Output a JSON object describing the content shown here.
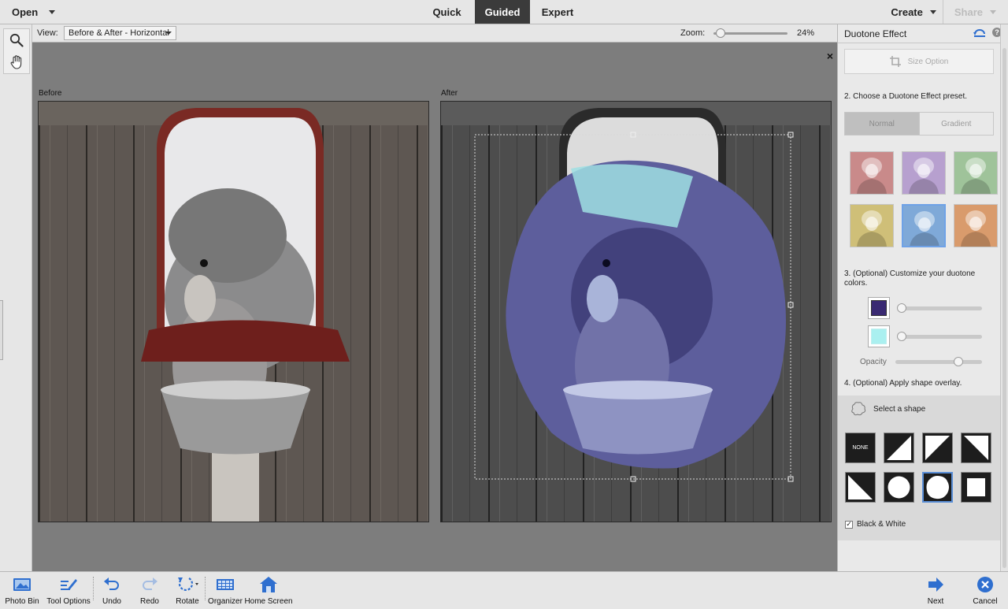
{
  "topbar": {
    "open_label": "Open",
    "modes": [
      {
        "label": "Quick",
        "active": false
      },
      {
        "label": "Guided",
        "active": true
      },
      {
        "label": "Expert",
        "active": false
      }
    ],
    "create_label": "Create",
    "share_label": "Share"
  },
  "viewbar": {
    "view_label": "View:",
    "view_value": "Before & After - Horizontal",
    "zoom_label": "Zoom:",
    "zoom_value": "24%",
    "zoom_level_fraction": 0.04
  },
  "canvas": {
    "before_label": "Before",
    "after_label": "After",
    "close_glyph": "×"
  },
  "panel": {
    "title": "Duotone Effect",
    "size_option": "Size Option",
    "step2": "2. Choose a Duotone Effect preset.",
    "segments": [
      {
        "label": "Normal",
        "active": true
      },
      {
        "label": "Gradient",
        "active": false
      }
    ],
    "presets": [
      {
        "name": "rose",
        "color": "#c98a8a",
        "selected": false
      },
      {
        "name": "lilac",
        "color": "#b7a0cf",
        "selected": false
      },
      {
        "name": "green",
        "color": "#9fc39a",
        "selected": false
      },
      {
        "name": "yellow",
        "color": "#cfbf78",
        "selected": false
      },
      {
        "name": "blue",
        "color": "#7fa9d8",
        "selected": true
      },
      {
        "name": "orange",
        "color": "#d99b6c",
        "selected": false
      }
    ],
    "step3": "3. (Optional) Customize your duotone colors.",
    "color1": "#3a2a72",
    "color2": "#aaf0f0",
    "color1_slider_fraction": 0.0,
    "color2_slider_fraction": 0.0,
    "opacity_label": "Opacity",
    "opacity_fraction": 0.76,
    "step4": "4. (Optional) Apply shape overlay.",
    "select_shape": "Select a shape",
    "shapes": [
      {
        "name": "none",
        "label": "NONE",
        "selected": false
      },
      {
        "name": "triangle-bottom-right",
        "selected": false
      },
      {
        "name": "triangle-top-left",
        "selected": false
      },
      {
        "name": "triangle-top-right",
        "selected": false
      },
      {
        "name": "triangle-bottom-left",
        "selected": false
      },
      {
        "name": "circle",
        "selected": false
      },
      {
        "name": "brush-blob",
        "selected": true
      },
      {
        "name": "square",
        "selected": false
      }
    ],
    "black_white_label": "Black & White",
    "black_white_checked": true
  },
  "bottombar": {
    "photo_bin": "Photo Bin",
    "tool_options": "Tool Options",
    "undo": "Undo",
    "redo": "Redo",
    "rotate": "Rotate",
    "organizer": "Organizer",
    "home_screen": "Home Screen",
    "next": "Next",
    "cancel": "Cancel"
  },
  "colors": {
    "accent_blue": "#2f6fcf",
    "active_mode_bg": "#3b3b3b"
  }
}
